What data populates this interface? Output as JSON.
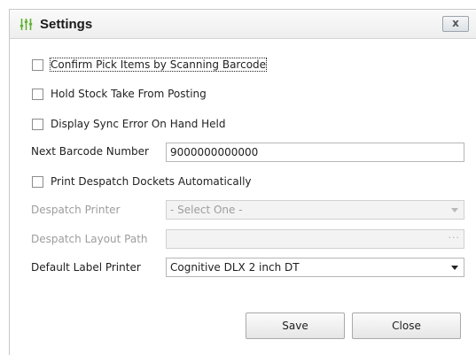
{
  "window": {
    "title": "Settings",
    "title_icon": "sliders-icon",
    "icon_color": "#5fb130",
    "close_label": "x"
  },
  "options": {
    "confirm_pick": {
      "label": "Confirm Pick Items by Scanning Barcode",
      "checked": false
    },
    "hold_stock": {
      "label": "Hold Stock Take From Posting",
      "checked": false
    },
    "display_sync": {
      "label": "Display Sync Error On Hand Held",
      "checked": false
    },
    "print_despatch": {
      "label": "Print Despatch Dockets Automatically",
      "checked": false
    }
  },
  "fields": {
    "next_barcode": {
      "label": "Next Barcode Number",
      "value": "9000000000000"
    },
    "despatch_printer": {
      "label": "Despatch Printer",
      "value": "- Select One -",
      "enabled": false
    },
    "despatch_layout": {
      "label": "Despatch Layout Path",
      "value": "",
      "button_label": "···",
      "enabled": false
    },
    "default_label_printer": {
      "label": "Default Label Printer",
      "value": "Cognitive DLX 2 inch DT"
    }
  },
  "buttons": {
    "save": "Save",
    "close": "Close"
  }
}
